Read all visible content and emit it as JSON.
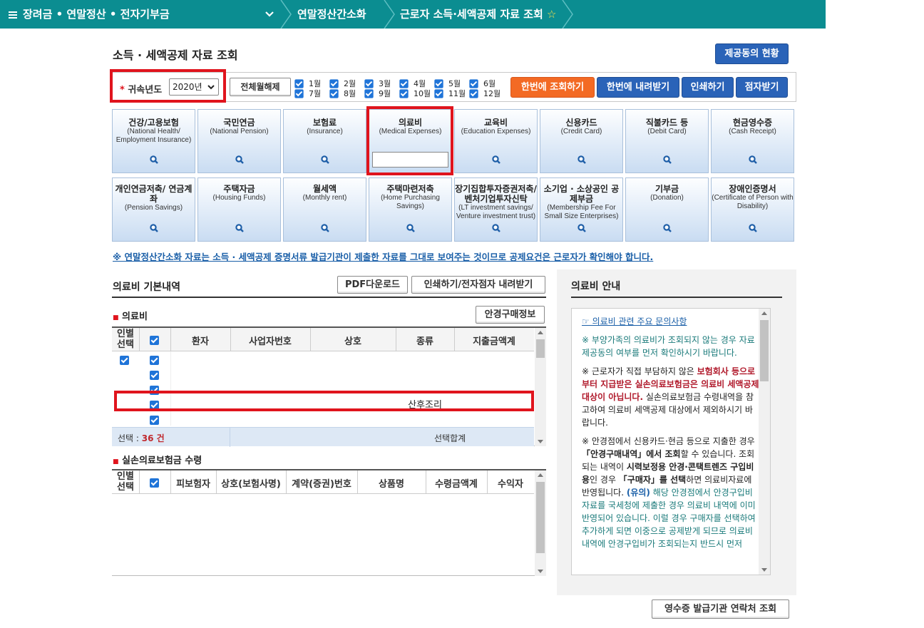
{
  "nav": {
    "section": "장려금 • 연말정산 • 전자기부금",
    "crumb1": "연말정산간소화",
    "crumb2": "근로자 소득·세액공제 자료 조회",
    "star": "☆"
  },
  "page": {
    "title": "소득 · 세액공제 자료 조회",
    "provider_status_btn": "제공동의 현황"
  },
  "filter": {
    "year_label": "귀속년도",
    "year_value": "2020년",
    "toggle_all_btn": "전체월해제",
    "months": [
      "1월",
      "2월",
      "3월",
      "4월",
      "5월",
      "6월",
      "7월",
      "8월",
      "9월",
      "10월",
      "11월",
      "12월"
    ],
    "query_all_btn": "한번에 조회하기",
    "download_all_btn": "한번에 내려받기",
    "print_btn": "인쇄하기",
    "stamp_btn": "점자받기"
  },
  "tiles_row1": [
    {
      "ko": "건강/고용보험",
      "en": "(National Health/ Employment Insurance)"
    },
    {
      "ko": "국민연금",
      "en": "(National Pension)"
    },
    {
      "ko": "보험료",
      "en": "(Insurance)"
    },
    {
      "ko": "의료비",
      "en": "(Medical Expenses)"
    },
    {
      "ko": "교육비",
      "en": "(Education Expenses)"
    },
    {
      "ko": "신용카드",
      "en": "(Credit Card)"
    },
    {
      "ko": "직불카드 등",
      "en": "(Debit Card)"
    },
    {
      "ko": "현금영수증",
      "en": "(Cash Receipt)"
    }
  ],
  "tiles_row2": [
    {
      "ko": "개인연금저축/ 연금계좌",
      "en": "(Pension Savings)"
    },
    {
      "ko": "주택자금",
      "en": "(Housing Funds)"
    },
    {
      "ko": "월세액",
      "en": "(Monthly rent)"
    },
    {
      "ko": "주택마련저축",
      "en": "(Home Purchasing Savings)"
    },
    {
      "ko": "장기집합투자증권저축/ 벤처기업투자신탁",
      "en": "(LT investment savings/ Venture investment trust)"
    },
    {
      "ko": "소기업 · 소상공인 공제부금",
      "en": "(Membership Fee For Small Size Enterprises)"
    },
    {
      "ko": "기부금",
      "en": "(Donation)"
    },
    {
      "ko": "장애인증명서",
      "en": "(Certificate of Person with Disability)"
    }
  ],
  "notice": "※ 연말정산간소화 자료는 소득 · 세액공제 증명서류 발급기관이 제출한 자료를 그대로 보여주는 것이므로 공제요건은 근로자가 확인해야 합니다.",
  "medical": {
    "title": "의료비 기본내역",
    "pdf_btn": "PDF다운로드",
    "print_btn": "인쇄하기/전자점자 내려받기",
    "sub": "의료비",
    "glasses_btn": "안경구매정보",
    "headers": [
      "인별 선택",
      "환자",
      "사업자번호",
      "상호",
      "종류",
      "지출금액계"
    ],
    "highlight_type": "산후조리",
    "select_label": "선택 :",
    "select_count": "36 건",
    "select_sum_label": "선택합계"
  },
  "insurance": {
    "sub": "실손의료보험금 수령",
    "headers": [
      "인별 선택",
      "피보험자",
      "상호(보험사명)",
      "계약(증권)번호",
      "상품명",
      "수령금액계",
      "수익자"
    ]
  },
  "guide": {
    "title": "의료비 안내",
    "link": "☞ 의료비 관련 주요 문의사항",
    "p1": "※ 부양가족의 의료비가 조회되지 않는 경우 자료제공동의 여부를 먼저 확인하시기 바랍니다.",
    "p2a": "※ 근로자가 직접 부담하지 않은 ",
    "p2b": "보험회사 등으로부터 지급받은 실손의료보험금은 의료비 세액공제 대상이 아닙니다.",
    "p2c": " 실손의료보험금 수령내역을 참고하여 의료비 세액공제 대상에서 제외하시기 바랍니다.",
    "p3a": "※ 안경점에서 신용카드·현금 등으로 지출한 경우 ",
    "p3b": "「안경구매내역」에서 조회",
    "p3c": "할 수 있습니다. 조회되는 내역이 ",
    "p3d": "시력보정용 안경·콘택트렌즈 구입비용",
    "p3e": "인 경우 ",
    "p3f": "「구매자」를 선택",
    "p3g": "하면 의료비자료에 반영됩니다. ",
    "p3h": "(유의)",
    "p3i": " 해당 안경점에서 안경구입비 자료를 국세청에 제출한 경우 의료비 내역에 이미 반영되어 있습니다. 이럴 경우 구매자를 선택하여 추가하게 되면 이중으로 공제받게 되므로 의료비 내역에 안경구입비가 조회되는지 반드시 먼저"
  },
  "receipt_btn": "영수증 발급기관 연락처 조회"
}
